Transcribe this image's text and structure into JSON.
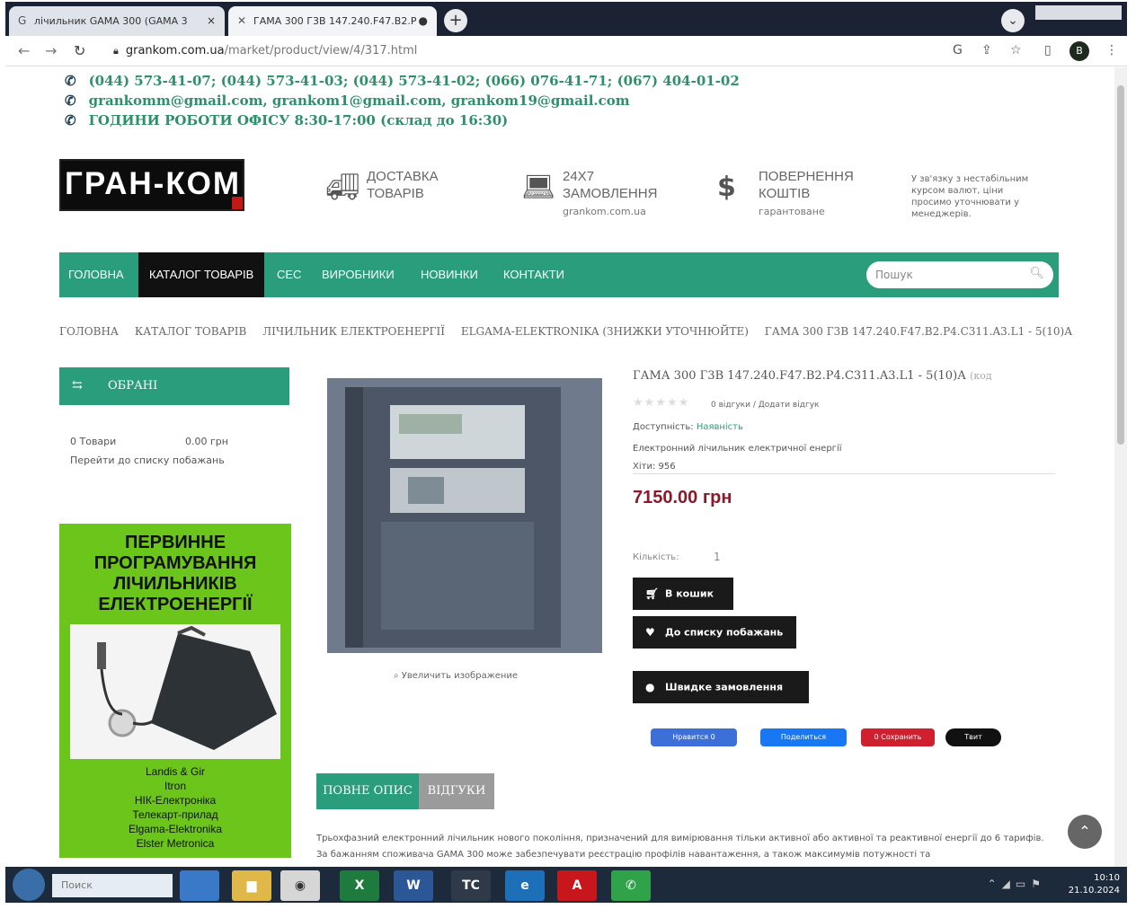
{
  "browser": {
    "tabs": [
      {
        "title": "лічильник GAMA 300 (GAMA 3",
        "close": "×"
      },
      {
        "title": "ГАМА 300 Г3В 147.240.F47.B2.P",
        "close": "●"
      }
    ],
    "new_tab": "+",
    "url_domain": "grankom.com.ua",
    "url_path": "/market/product/view/4/317.html",
    "profile_initial": "В"
  },
  "contacts": {
    "phones": "(044) 573-41-07; (044) 573-41-03; (044) 573-41-02; (066) 076-41-71; (067) 404-01-02",
    "emails": "grankomm@gmail.com, grankom1@gmail.com, grankom19@gmail.com",
    "hours": "ГОДИНИ РОБОТИ ОФІСУ  8:30-17:00 (склад до 16:30)"
  },
  "logo": {
    "text": "ГРАН-КОМ"
  },
  "features": [
    {
      "title": "ДОСТАВКА ТОВАРІВ",
      "sub": "",
      "icon": "truck-icon"
    },
    {
      "title": "24Х7 ЗАМОВЛЕННЯ",
      "sub": "grankom.com.ua",
      "icon": "laptop-icon"
    },
    {
      "title": "ПОВЕРНЕННЯ КОШТІВ",
      "sub": "гарантоване",
      "icon": "dollar-icon"
    }
  ],
  "notice": "У зв'язку з нестабільним курсом валют, ціни просимо уточнювати у менеджерів.",
  "nav": {
    "items": [
      "ГОЛОВНА",
      "КАТАЛОГ ТОВАРІВ",
      "СЕС",
      "ВИРОБНИКИ",
      "НОВИНКИ",
      "КОНТАКТИ"
    ],
    "active_index": 1,
    "search_placeholder": "Пошук"
  },
  "breadcrumbs": [
    "ГОЛОВНА",
    "КАТАЛОГ ТОВАРІВ",
    "ЛІЧИЛЬНИК ЕЛЕКТРОЕНЕРГІЇ",
    "ELGAMA-ELEKTRONIKA (ЗНИЖКИ УТОЧНЮЙТЕ)",
    "ГАМА 300 Г3В 147.240.F47.B2.P4.C311.A3.L1 - 5(10)А"
  ],
  "favorites": {
    "title": "ОБРАНІ",
    "count": "0 Товари",
    "sum": "0.00 грн",
    "link": "Перейти до списку побажань"
  },
  "banner": {
    "heading": "ПЕРВИННЕ ПРОГРАМУВАННЯ ЛІЧИЛЬНИКІВ ЕЛЕКТРОЕНЕРГІЇ",
    "brands": [
      "Landis & Gir",
      "Itron",
      "НІК-Електроніка",
      "Телекарт-прилад",
      "Elgama-Elektronika",
      "Elster Metronica"
    ]
  },
  "product": {
    "title": "ГАМА 300 Г3В 147.240.F47.B2.P4.C311.A3.L1 - 5(10)А",
    "code": "(код",
    "reviews": "0 відгуки / Додати відгук",
    "availability_label": "Доступність:",
    "availability_value": "Наявність",
    "description": "Електронний лічильник електричної енергії",
    "hits": "Хіти: 956",
    "price": "7150.00 грн",
    "qty_label": "Кількість:",
    "qty_value": "1",
    "zoom": "Увеличить изображение",
    "btn_cart": "В кошик",
    "btn_wish": "До списку побажань",
    "btn_quick": "Швидке замовлення",
    "social": [
      "Нравится 0",
      "Поделиться",
      "0 Сохранить",
      "Твит"
    ]
  },
  "tabs": {
    "full": "ПОВНЕ ОПИС",
    "reviews": "ВІДГУКИ"
  },
  "desc_text": "Трьохфазний електронний лічильник нового покоління, призначений для вимірювання тільки активної або активної та реактивної енергії до 6 тарифів. За бажанням споживача GAMA 300 може забезпечувати реєстрацію профілів навантаження, а також максимумів потужності та",
  "taskbar": {
    "search": "Поиск",
    "apps": [
      "Chrome",
      "Excel",
      "Word",
      "TC",
      "Edge",
      "Acrobat",
      "Viber"
    ],
    "clock_time": "10:10",
    "clock_date": "21.10.2024"
  }
}
